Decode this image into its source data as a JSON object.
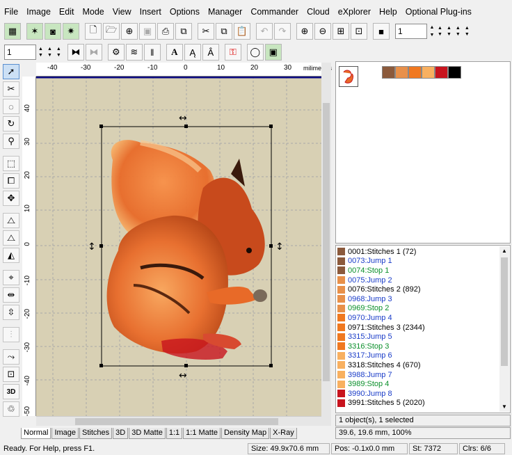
{
  "menu": [
    "File",
    "Image",
    "Edit",
    "Mode",
    "View",
    "Insert",
    "Options",
    "Manager",
    "Commander",
    "Cloud",
    "eXplorer",
    "Help",
    "Optional Plug-ins"
  ],
  "toolbar1": {
    "zoom_value": "1"
  },
  "toolbar2": {
    "value": "1"
  },
  "ruler": {
    "unit": "milimeters",
    "x_ticks": [
      "-40",
      "-30",
      "-20",
      "-10",
      "0",
      "10",
      "20",
      "30"
    ],
    "y_ticks": [
      "40",
      "30",
      "20",
      "10",
      "0",
      "-10",
      "-20",
      "-30",
      "-40",
      "-50"
    ]
  },
  "palette": [
    "#8b5a3c",
    "#e8904a",
    "#f07820",
    "#f8b060",
    "#c8141e",
    "#000000"
  ],
  "objects": [
    {
      "num": "0001:",
      "label": "Stitches 1 (72)",
      "type": "stitches",
      "color": "#8b5a3c"
    },
    {
      "num": "0073:",
      "label": "Jump 1",
      "type": "jump",
      "color": "#8b5a3c"
    },
    {
      "num": "0074:",
      "label": "Stop 1",
      "type": "stop",
      "color": "#8b5a3c"
    },
    {
      "num": "0075:",
      "label": "Jump 2",
      "type": "jump",
      "color": "#e8904a"
    },
    {
      "num": "0076:",
      "label": "Stitches 2 (892)",
      "type": "stitches",
      "color": "#e8904a"
    },
    {
      "num": "0968:",
      "label": "Jump 3",
      "type": "jump",
      "color": "#e8904a"
    },
    {
      "num": "0969:",
      "label": "Stop 2",
      "type": "stop",
      "color": "#e8904a"
    },
    {
      "num": "0970:",
      "label": "Jump 4",
      "type": "jump",
      "color": "#f07820"
    },
    {
      "num": "0971:",
      "label": "Stitches 3 (2344)",
      "type": "stitches",
      "color": "#f07820"
    },
    {
      "num": "3315:",
      "label": "Jump 5",
      "type": "jump",
      "color": "#f07820"
    },
    {
      "num": "3316:",
      "label": "Stop 3",
      "type": "stop",
      "color": "#f07820"
    },
    {
      "num": "3317:",
      "label": "Jump 6",
      "type": "jump",
      "color": "#f8b060"
    },
    {
      "num": "3318:",
      "label": "Stitches 4 (670)",
      "type": "stitches",
      "color": "#f8b060"
    },
    {
      "num": "3988:",
      "label": "Jump 7",
      "type": "jump",
      "color": "#f8b060"
    },
    {
      "num": "3989:",
      "label": "Stop 4",
      "type": "stop",
      "color": "#f8b060"
    },
    {
      "num": "3990:",
      "label": "Jump 8",
      "type": "jump",
      "color": "#c8141e"
    },
    {
      "num": "3991:",
      "label": "Stitches 5 (2020)",
      "type": "stitches",
      "color": "#c8141e"
    }
  ],
  "selection_info": "1 object(s), 1 selected",
  "coord_info": "39.6, 19.6 mm, 100%",
  "tabs": [
    "Normal",
    "Image",
    "Stitches",
    "3D",
    "3D Matte",
    "1:1",
    "1:1 Matte",
    "Density Map",
    "X-Ray"
  ],
  "status": {
    "message": "Ready. For Help, press F1.",
    "size": "Size: 49.9x70.6 mm",
    "pos": "Pos: -0.1x0.0 mm",
    "stitches": "St: 7372",
    "colors": "Clrs: 6/6"
  }
}
